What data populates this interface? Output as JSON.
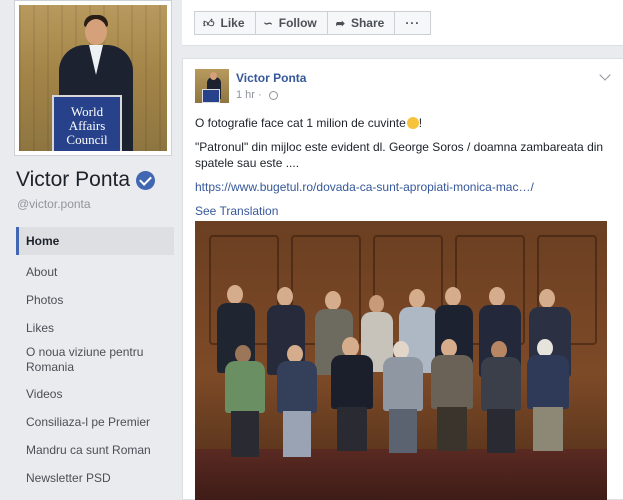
{
  "profile": {
    "photo_podium_lines": [
      "World",
      "Affairs",
      "Council"
    ],
    "name": "Victor Ponta",
    "handle": "@victor.ponta",
    "verified": true
  },
  "nav": {
    "items": [
      {
        "label": "Home",
        "active": true
      },
      {
        "label": "About"
      },
      {
        "label": "Photos"
      },
      {
        "label": "Likes"
      },
      {
        "label": "O noua viziune pentru Romania"
      },
      {
        "label": "Videos"
      },
      {
        "label": "Consiliaza-l pe Premier"
      },
      {
        "label": "Mandru ca sunt Roman"
      },
      {
        "label": "Newsletter PSD"
      }
    ]
  },
  "actions": {
    "like": "Like",
    "follow": "Follow",
    "share": "Share",
    "more": "···"
  },
  "post": {
    "author": "Victor Ponta",
    "time": "1 hr",
    "line1": "O fotografie face cat 1 milion de cuvinte",
    "line1_end": "!",
    "line2": "\"Patronul\" din mijloc este evident dl. George Soros / doamna zambareata din spatele sau este ....",
    "link": "https://www.bugetul.ro/dovada-ca-sunt-apropiati-monica-mac…/",
    "see_translation": "See Translation"
  },
  "colors": {
    "fb_blue": "#4267b2",
    "link": "#365899",
    "background": "#e9ebee"
  }
}
